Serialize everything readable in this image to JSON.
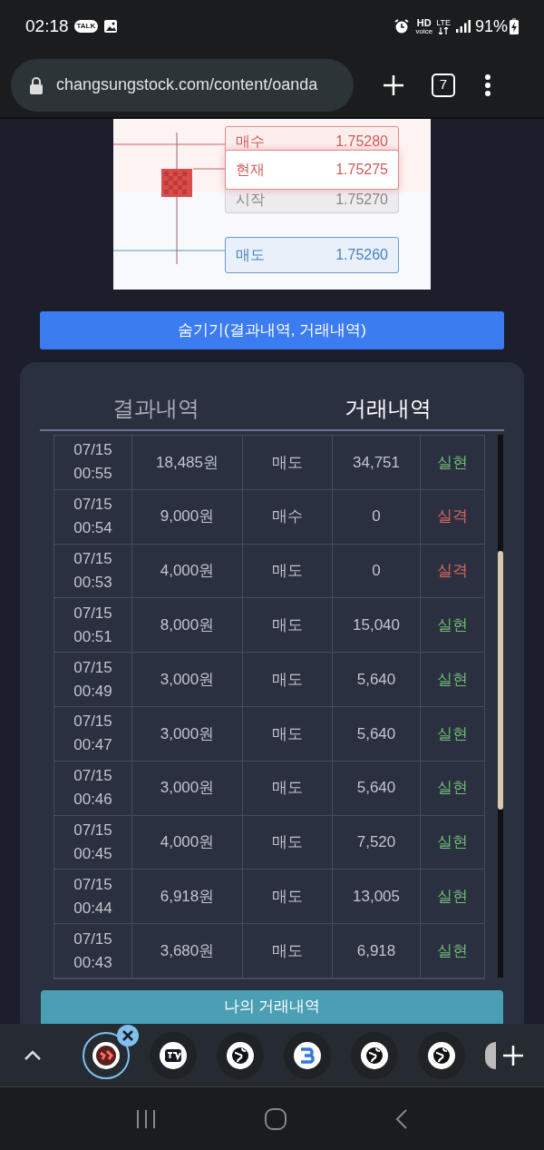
{
  "status_bar": {
    "time": "02:18",
    "talk_badge": "TALK",
    "hd": "HD",
    "voice": "voice",
    "lte": "LTE",
    "battery": "91%"
  },
  "browser": {
    "url": "changsungstock.com/content/oanda",
    "tab_count": "7"
  },
  "price_chart": {
    "labels": [
      {
        "kind": "buy",
        "name": "매수",
        "value": "1.75280"
      },
      {
        "kind": "current",
        "name": "현재",
        "value": "1.75275"
      },
      {
        "kind": "open",
        "name": "시작",
        "value": "1.75270"
      },
      {
        "kind": "sell",
        "name": "매도",
        "value": "1.75260"
      }
    ]
  },
  "hide_button": "숨기기(결과내역, 거래내역)",
  "tabs": [
    {
      "label": "결과내역",
      "selected": false
    },
    {
      "label": "거래내역",
      "selected": true
    }
  ],
  "rows": [
    {
      "date": "07/15",
      "time": "00:55",
      "amount": "18,485원",
      "side": "매도",
      "value": "34,751",
      "result": "실현",
      "kind": "win"
    },
    {
      "date": "07/15",
      "time": "00:54",
      "amount": "9,000원",
      "side": "매수",
      "value": "0",
      "result": "실격",
      "kind": "loss"
    },
    {
      "date": "07/15",
      "time": "00:53",
      "amount": "4,000원",
      "side": "매도",
      "value": "0",
      "result": "실격",
      "kind": "loss"
    },
    {
      "date": "07/15",
      "time": "00:51",
      "amount": "8,000원",
      "side": "매도",
      "value": "15,040",
      "result": "실현",
      "kind": "win"
    },
    {
      "date": "07/15",
      "time": "00:49",
      "amount": "3,000원",
      "side": "매도",
      "value": "5,640",
      "result": "실현",
      "kind": "win"
    },
    {
      "date": "07/15",
      "time": "00:47",
      "amount": "3,000원",
      "side": "매도",
      "value": "5,640",
      "result": "실현",
      "kind": "win"
    },
    {
      "date": "07/15",
      "time": "00:46",
      "amount": "3,000원",
      "side": "매도",
      "value": "5,640",
      "result": "실현",
      "kind": "win"
    },
    {
      "date": "07/15",
      "time": "00:45",
      "amount": "4,000원",
      "side": "매도",
      "value": "7,520",
      "result": "실현",
      "kind": "win"
    },
    {
      "date": "07/15",
      "time": "00:44",
      "amount": "6,918원",
      "side": "매도",
      "value": "13,005",
      "result": "실현",
      "kind": "win"
    },
    {
      "date": "07/15",
      "time": "00:43",
      "amount": "3,680원",
      "side": "매도",
      "value": "6,918",
      "result": "실현",
      "kind": "win"
    }
  ],
  "history_button": "나의 거래내역",
  "tab_strip": [
    {
      "selected": true
    },
    {
      "selected": false
    },
    {
      "selected": false
    },
    {
      "selected": false
    },
    {
      "selected": false
    },
    {
      "selected": false
    }
  ]
}
